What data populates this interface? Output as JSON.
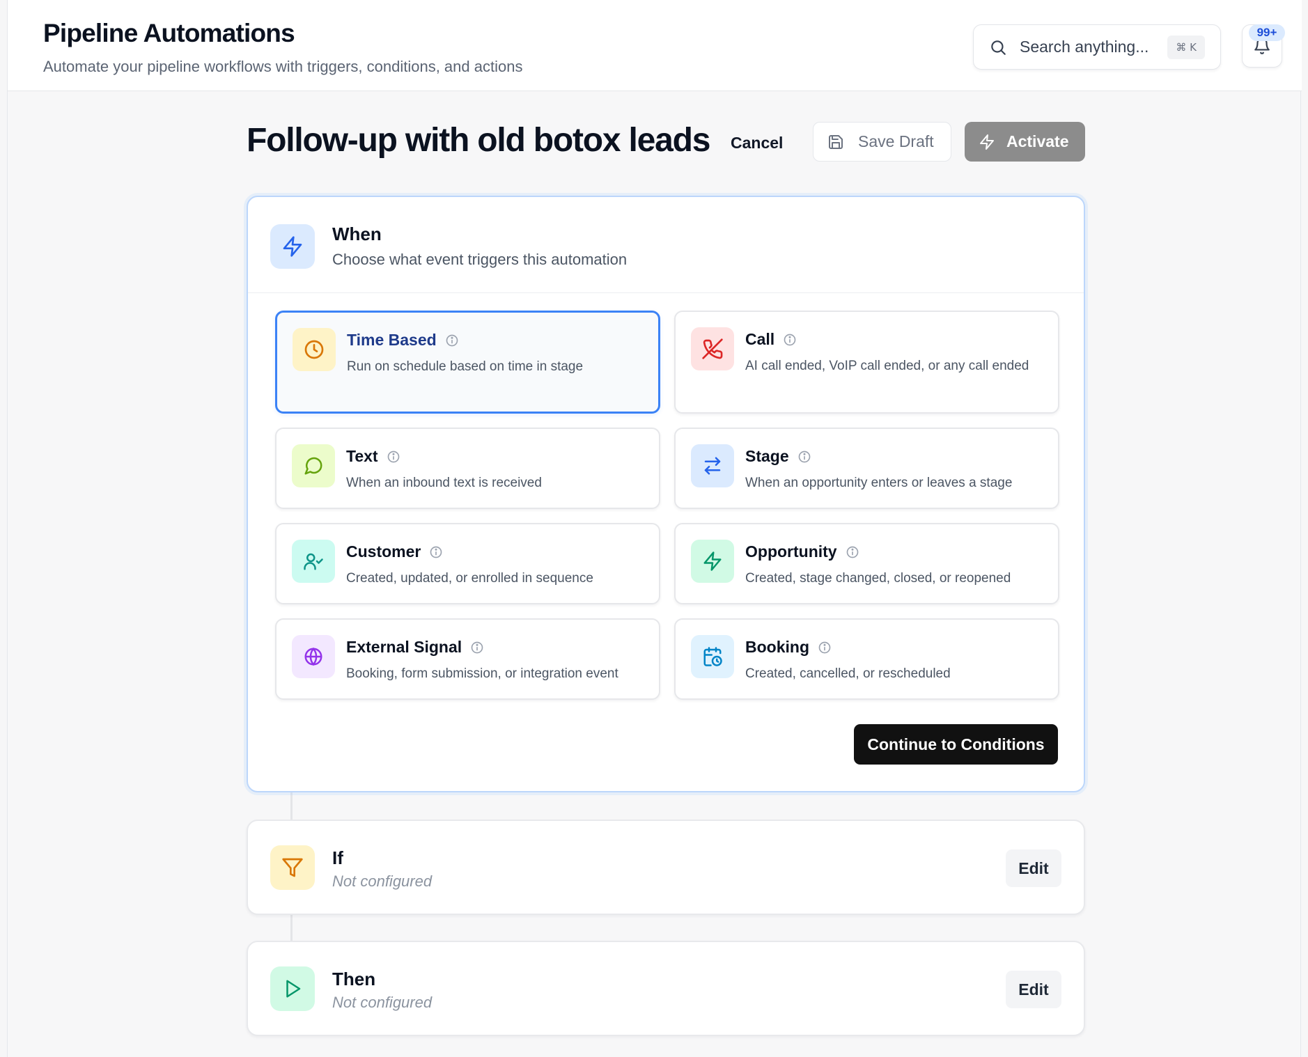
{
  "header": {
    "title": "Pipeline Automations",
    "subtitle": "Automate your pipeline workflows with triggers, conditions, and actions",
    "search_placeholder": "Search anything...",
    "search_shortcut": "⌘ K",
    "notification_count": "99+"
  },
  "automation": {
    "name": "Follow-up with old botox leads",
    "cancel_label": "Cancel",
    "save_draft_label": "Save Draft",
    "activate_label": "Activate"
  },
  "when": {
    "title": "When",
    "subtitle": "Choose what event triggers this automation",
    "continue_label": "Continue to Conditions",
    "selected": "time-based",
    "options": [
      {
        "id": "time-based",
        "title": "Time Based",
        "desc": "Run on schedule based on time in stage",
        "icon": "clock-icon",
        "color": "#d97706",
        "bg": "#fef3c7"
      },
      {
        "id": "call",
        "title": "Call",
        "desc": "AI call ended, VoIP call ended, or any call ended",
        "icon": "phone-off-icon",
        "color": "#dc2626",
        "bg": "#fee2e2"
      },
      {
        "id": "text",
        "title": "Text",
        "desc": "When an inbound text is received",
        "icon": "message-circle-icon",
        "color": "#65a30d",
        "bg": "#ecfccb"
      },
      {
        "id": "stage",
        "title": "Stage",
        "desc": "When an opportunity enters or leaves a stage",
        "icon": "arrows-left-right-icon",
        "color": "#2563eb",
        "bg": "#dbeafe"
      },
      {
        "id": "customer",
        "title": "Customer",
        "desc": "Created, updated, or enrolled in sequence",
        "icon": "user-check-icon",
        "color": "#0d9488",
        "bg": "#ccfbf1"
      },
      {
        "id": "opportunity",
        "title": "Opportunity",
        "desc": "Created, stage changed, closed, or reopened",
        "icon": "lightning-icon",
        "color": "#059669",
        "bg": "#d1fae5"
      },
      {
        "id": "external-signal",
        "title": "External Signal",
        "desc": "Booking, form submission, or integration event",
        "icon": "globe-icon",
        "color": "#9333ea",
        "bg": "#f3e8ff"
      },
      {
        "id": "booking",
        "title": "Booking",
        "desc": "Created, cancelled, or rescheduled",
        "icon": "calendar-clock-icon",
        "color": "#0284c7",
        "bg": "#e0f2fe"
      }
    ]
  },
  "if_step": {
    "title": "If",
    "status": "Not configured",
    "edit_label": "Edit",
    "icon": "filter-icon",
    "color": "#d97706",
    "bg": "#fef3c7"
  },
  "then_step": {
    "title": "Then",
    "status": "Not configured",
    "edit_label": "Edit",
    "icon": "play-icon",
    "color": "#059669",
    "bg": "#d1fae5"
  }
}
